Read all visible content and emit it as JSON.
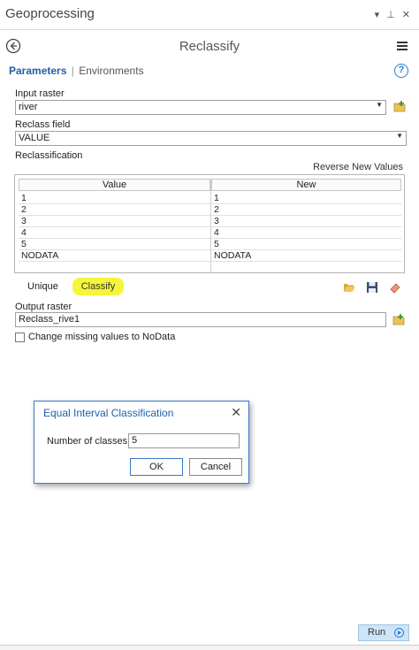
{
  "window": {
    "title": "Geoprocessing",
    "controls": [
      "▾",
      "⊥",
      "✕"
    ]
  },
  "tool": {
    "title": "Reclassify"
  },
  "tabs": {
    "parameters": "Parameters",
    "separator": "|",
    "environments": "Environments"
  },
  "help": {
    "glyph": "?"
  },
  "input_raster": {
    "label": "Input raster",
    "value": "river"
  },
  "reclass_field": {
    "label": "Reclass field",
    "value": "VALUE"
  },
  "reclassification": {
    "label": "Reclassification",
    "reverse_label": "Reverse New Values",
    "columns": [
      "Value",
      "New"
    ],
    "rows": [
      [
        "1",
        "1"
      ],
      [
        "2",
        "2"
      ],
      [
        "3",
        "3"
      ],
      [
        "4",
        "4"
      ],
      [
        "5",
        "5"
      ],
      [
        "NODATA",
        "NODATA"
      ],
      [
        "",
        ""
      ]
    ]
  },
  "buttons": {
    "unique": "Unique",
    "classify": "Classify"
  },
  "output_raster": {
    "label": "Output raster",
    "value": "Reclass_rive1"
  },
  "missing_values": {
    "label": "Change missing values to NoData",
    "checked": false
  },
  "dialog": {
    "title": "Equal Interval Classification",
    "close": "✕",
    "classes_label": "Number of classes",
    "classes_value": "5",
    "ok": "OK",
    "cancel": "Cancel"
  },
  "run": {
    "label": "Run"
  },
  "colors": {
    "accent": "#1f5fa8",
    "highlight": "#f5f53a",
    "run_bg": "#cfe5f5"
  }
}
